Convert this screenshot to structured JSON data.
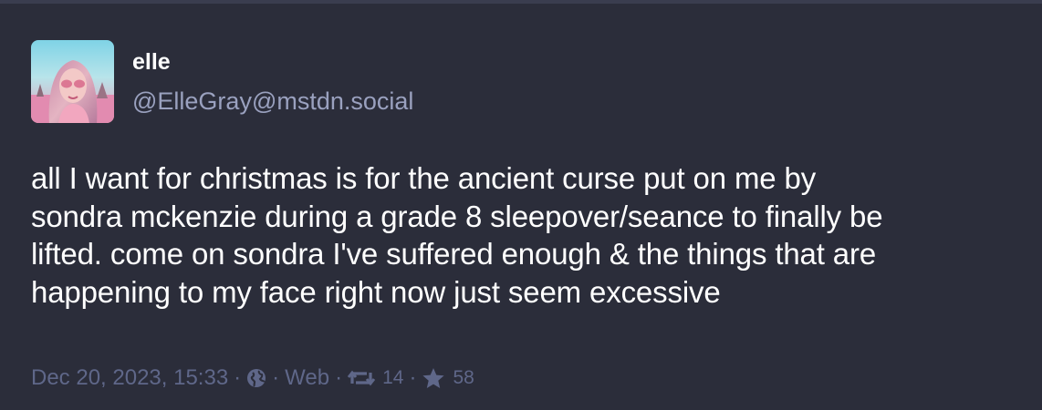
{
  "post": {
    "author": {
      "display_name": "elle",
      "handle": "@ElleGray@mstdn.social"
    },
    "content_lines": [
      "all I want for christmas is for the ancient curse put on me by",
      "sondra mckenzie during a grade 8 sleepover/seance to finally be",
      "lifted. come on sondra I've suffered enough & the things that are",
      "happening to my face right now just seem excessive"
    ],
    "meta": {
      "timestamp": "Dec 20, 2023, 15:33",
      "separator": "·",
      "visibility_icon": "globe-icon",
      "client": "Web",
      "boost_icon": "boost-icon",
      "boost_count": "14",
      "favourite_icon": "star-icon",
      "favourite_count": "58"
    }
  },
  "colors": {
    "background": "#2b2d3a",
    "text_primary": "#ffffff",
    "handle": "#9aa1bf",
    "meta": "#5f6789"
  }
}
